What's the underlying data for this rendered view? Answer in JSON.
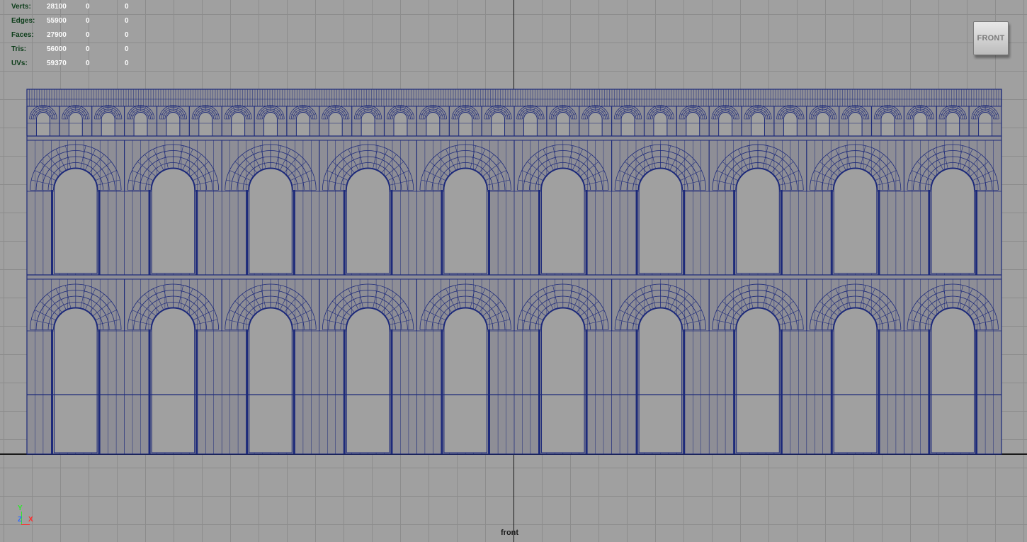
{
  "hud": {
    "rows": [
      {
        "label": "Verts:",
        "v1": "28100",
        "v2": "0",
        "v3": "0"
      },
      {
        "label": "Edges:",
        "v1": "55900",
        "v2": "0",
        "v3": "0"
      },
      {
        "label": "Faces:",
        "v1": "27900",
        "v2": "0",
        "v3": "0"
      },
      {
        "label": "Tris:",
        "v1": "56000",
        "v2": "0",
        "v3": "0"
      },
      {
        "label": "UVs:",
        "v1": "59370",
        "v2": "0",
        "v3": "0"
      }
    ]
  },
  "view_cube": {
    "label": "FRONT"
  },
  "camera": {
    "name": "front"
  },
  "axis_gizmo": {
    "y": "Y",
    "z": "Z",
    "x": "X"
  },
  "model": {
    "type": "wireframe-arcade",
    "upper_arches": 10,
    "lower_arches": 10,
    "small_arches": 30,
    "wire_color": "#1d2a7a",
    "face_color": "#8e8e96"
  },
  "colors": {
    "viewport_bg": "#a0a0a0",
    "grid_line": "#8c8c8c",
    "hud_label": "#0d3d1a",
    "hud_value": "#fbfbfb"
  }
}
